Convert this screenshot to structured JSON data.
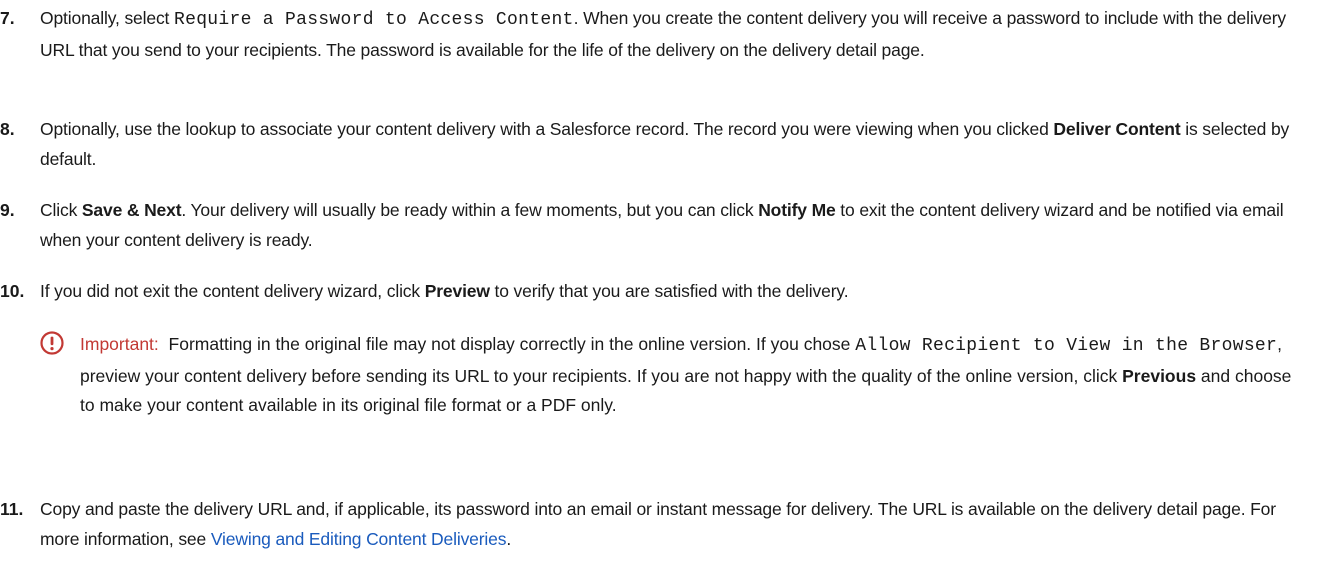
{
  "steps": [
    {
      "number": "7.",
      "t1": "Optionally, select ",
      "code1": "Require a Password to Access Content",
      "t2": ". When you create the content delivery you will receive a password to include with the delivery URL that you send to your recipients. The password is available for the life of the delivery on the delivery detail page."
    },
    {
      "number": "8.",
      "t1": "Optionally, use the lookup to associate your content delivery with a Salesforce record. The record you were viewing when you clicked ",
      "b1": "Deliver Content",
      "t2": " is selected by default."
    },
    {
      "number": "9.",
      "t1": "Click ",
      "b1": "Save & Next",
      "t2": ". Your delivery will usually be ready within a few moments, but you can click ",
      "b2": "Notify Me",
      "t3": " to exit the content delivery wizard and be notified via email when your content delivery is ready."
    },
    {
      "number": "10.",
      "t1": "If you did not exit the content delivery wizard, click ",
      "b1": "Preview",
      "t2": " to verify that you are satisfied with the delivery."
    },
    {
      "number": "11.",
      "t1": "Copy and paste the delivery URL and, if applicable, its password into an email or instant message for delivery. The URL is available on the delivery detail page. For more information, see ",
      "link": "Viewing and Editing Content Deliveries",
      "t2": "."
    }
  ],
  "note": {
    "label": "Important:",
    "t1": "Formatting in the original file may not display correctly in the online version. If you chose ",
    "code1": "Allow Recipient to View in the Browser",
    "t2": ", preview your content delivery before sending its URL to your recipients. If you are not happy with the quality of the online version, click ",
    "b1": "Previous",
    "t3": " and choose to make your content available in its original file format or a PDF only.",
    "icon": "important-icon",
    "color": "#c23934"
  },
  "colors": {
    "text": "#1a1a1a",
    "link": "#1a5bbd",
    "important": "#c23934"
  }
}
